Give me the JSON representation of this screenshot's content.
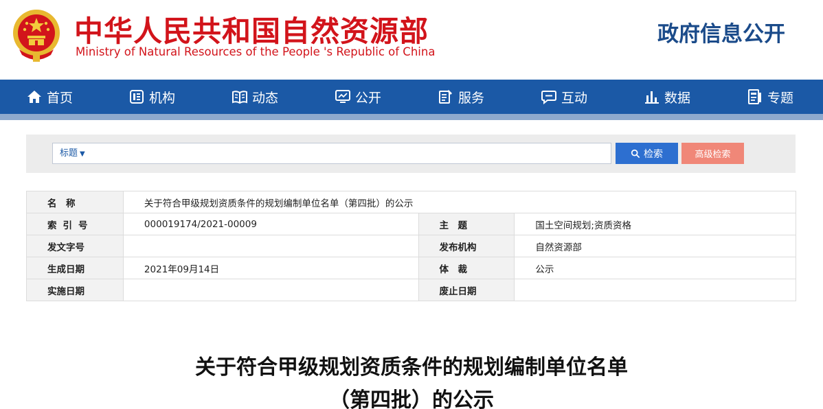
{
  "header": {
    "title_cn": "中华人民共和国自然资源部",
    "title_en": "Ministry of Natural Resources of the People 's Republic of China",
    "section": "政府信息公开",
    "colors": {
      "brand_red": "#d2141b",
      "brand_blue": "#1b4b8a"
    }
  },
  "nav": {
    "items": [
      {
        "label": "首页",
        "icon": "home-icon"
      },
      {
        "label": "机构",
        "icon": "organization-icon"
      },
      {
        "label": "动态",
        "icon": "book-icon"
      },
      {
        "label": "公开",
        "icon": "monitor-icon"
      },
      {
        "label": "服务",
        "icon": "edit-document-icon"
      },
      {
        "label": "互动",
        "icon": "chat-icon"
      },
      {
        "label": "数据",
        "icon": "bar-chart-icon"
      },
      {
        "label": "专题",
        "icon": "topic-icon"
      }
    ],
    "background": "#1b59a6"
  },
  "search": {
    "type_label": "标题",
    "query": "",
    "search_button": "检索",
    "advanced_button": "高级检索"
  },
  "info": {
    "name_label": "名　称",
    "name_value": "关于符合甲级规划资质条件的规划编制单位名单（第四批）的公示",
    "index_label": "索引号",
    "index_value": "000019174/2021-00009",
    "topic_label": "主　题",
    "topic_value": "国土空间规划;资质资格",
    "doc_no_label": "发文字号",
    "doc_no_value": "",
    "issuer_label": "发布机构",
    "issuer_value": "自然资源部",
    "date_label": "生成日期",
    "date_value": "2021年09月14日",
    "genre_label": "体　裁",
    "genre_value": "公示",
    "effective_label": "实施日期",
    "effective_value": "",
    "expiry_label": "废止日期",
    "expiry_value": ""
  },
  "article": {
    "title_line1": "关于符合甲级规划资质条件的规划编制单位名单",
    "title_line2": "（第四批）的公示"
  }
}
